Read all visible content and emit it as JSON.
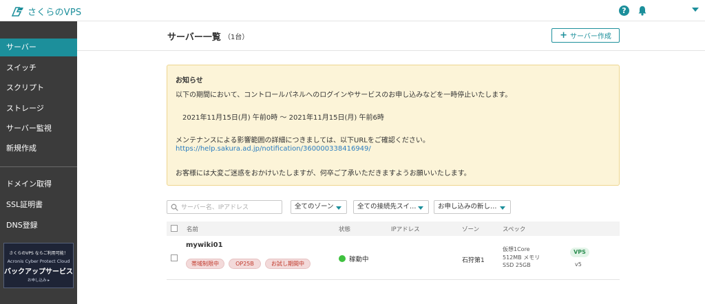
{
  "header": {
    "logo_text": "さくらのVPS",
    "help_icon": "question-circle-icon",
    "help_glyph": "?",
    "notification_icon": "bell-icon",
    "user_menu_icon": "caret-down-icon",
    "accent_color": "#1c8f9b"
  },
  "sidebar": {
    "items": [
      {
        "label": "サーバー",
        "active": true
      },
      {
        "label": "スイッチ"
      },
      {
        "label": "スクリプト"
      },
      {
        "label": "ストレージ"
      },
      {
        "label": "サーバー監視"
      },
      {
        "label": "新規作成"
      },
      {
        "label": "ドメイン取得"
      },
      {
        "label": "SSL証明書"
      },
      {
        "label": "DNS登録"
      }
    ],
    "banner": {
      "line1": "さくらのVPS ならご利用可能！",
      "line2": "Acronis Cyber Protect Cloud",
      "line3": "バックアップサービス",
      "line4": "お申し込み ▸"
    }
  },
  "page": {
    "title": "サーバー一覧",
    "count": "（1台）",
    "create_button_icon": "plus-icon",
    "create_button_glyph": "+",
    "create_button": "サーバー作成"
  },
  "notice": {
    "title": "お知らせ",
    "line1": "以下の期間において、コントロールパネルへのログインやサービスのお申し込みなどを一時停止いたします。",
    "period": "2021年11月15日(月) 午前0時 ～ 2021年11月15日(月) 午前6時",
    "line2": "メンテナンスによる影響範囲の詳細につきましては、以下URLをご確認ください。",
    "link": "https://help.sakura.ad.jp/notification/360000338416949/",
    "line3": "お客様には大変ご迷惑をおかけいたしますが、何卒ご了承いただきますようお願いいたします。"
  },
  "filters": {
    "search_placeholder": "サーバー名、IPアドレス",
    "zone_select": "全てのゾーン",
    "switch_select": "全ての接続先スイ…",
    "order_select": "お申し込みの新し…"
  },
  "table": {
    "columns": [
      "名前",
      "状態",
      "IPアドレス",
      "ゾーン",
      "スペック"
    ],
    "rows": [
      {
        "name": "mywiki01",
        "tags": [
          "帯域制限中",
          "OP25B",
          "お試し期間中"
        ],
        "status": "稼動中",
        "ip": "",
        "zone": "石狩第1",
        "spec": [
          "仮想1Core",
          "512MB メモリ",
          "SSD 25GB"
        ],
        "plan": "VPS",
        "version": "v5"
      }
    ]
  }
}
